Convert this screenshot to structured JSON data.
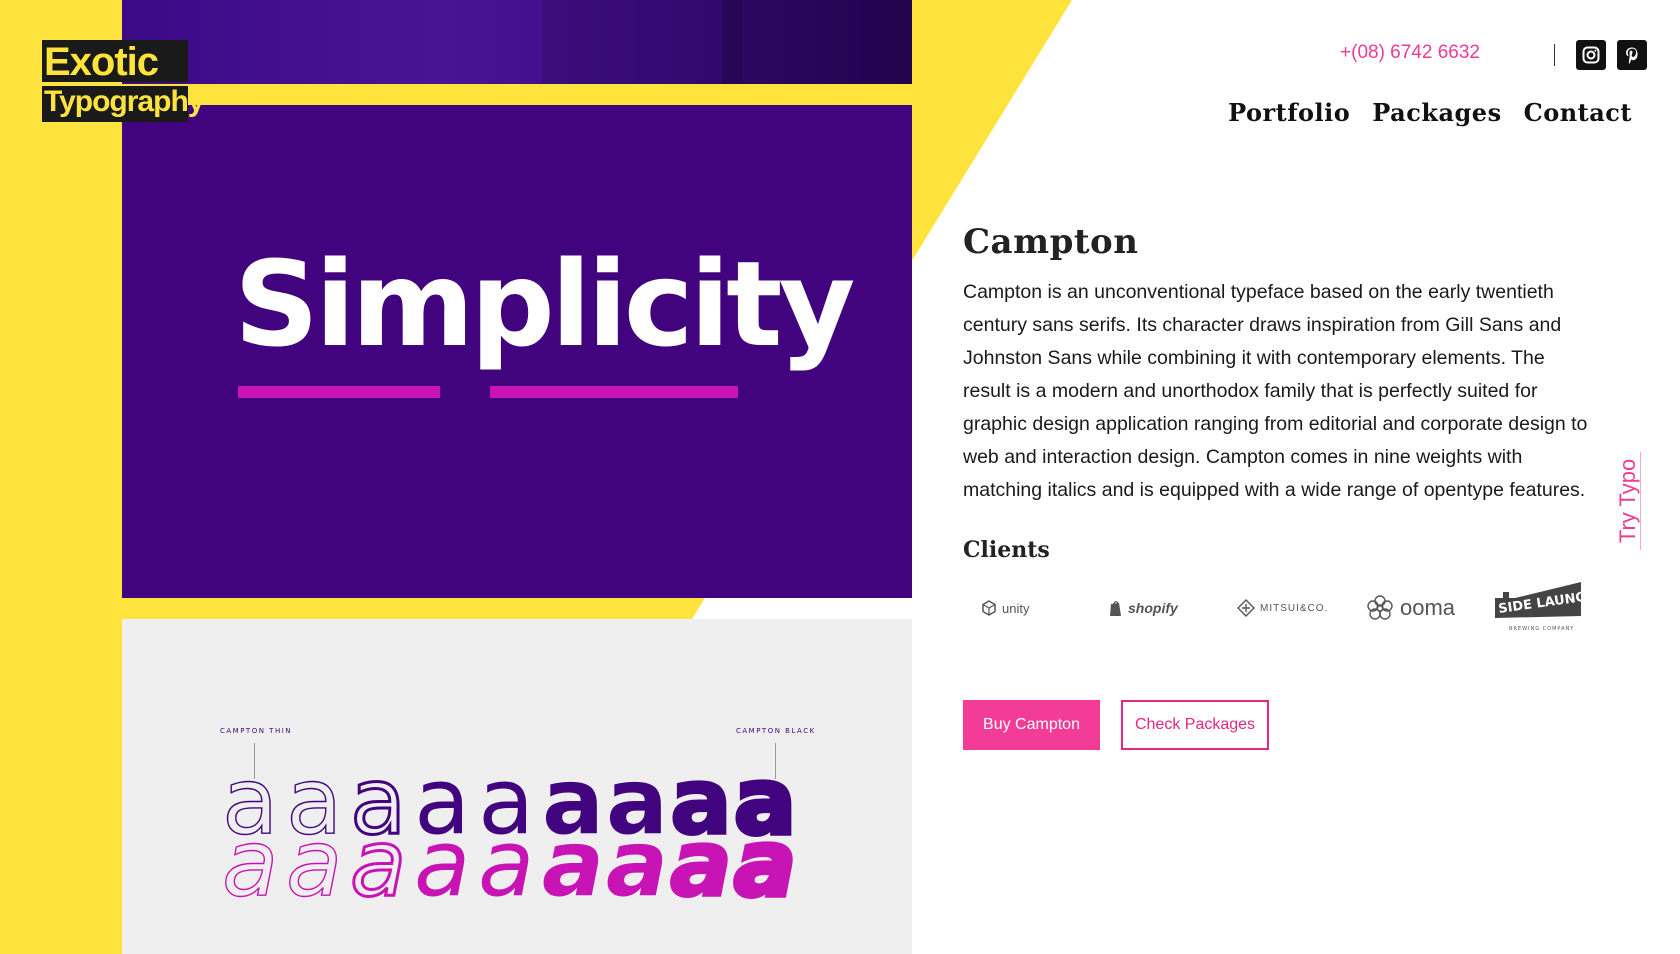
{
  "brand": {
    "logo_line1": "Exotic",
    "logo_line2": "Typography"
  },
  "header": {
    "phone": "+(08) 6742 6632",
    "social": [
      "instagram-icon",
      "pinterest-icon"
    ],
    "nav": [
      "Portfolio",
      "Packages",
      "Contact"
    ]
  },
  "hero": {
    "word": "Simplicity"
  },
  "weights": {
    "label_thin": "CAMPTON THIN",
    "label_black": "CAMPTON BLACK",
    "glyph": "a",
    "upright_colors": [
      "#42047e",
      "#42047e",
      "#42047e",
      "#42047e",
      "#42047e",
      "#42047e",
      "#42047e",
      "#42047e",
      "#42047e"
    ],
    "italic_colors": [
      "#c814b4",
      "#c814b4",
      "#c814b4",
      "#c814b4",
      "#c814b4",
      "#c814b4",
      "#c814b4",
      "#c814b4",
      "#c814b4"
    ],
    "weights_sequence": [
      100,
      200,
      300,
      400,
      500,
      600,
      700,
      800,
      900
    ]
  },
  "font": {
    "title": "Campton",
    "description": "Campton is an unconventional typeface based on the early twentieth century sans serifs. Its character draws inspiration from Gill Sans and Johnston Sans while combining it with contemporary elements. The result is a modern and unorthodox family that is perfectly suited for graphic design application ranging from editorial and corporate design to web and interaction design. Campton comes in nine weights with matching italics and is equipped with a wide range of opentype features."
  },
  "clients": {
    "heading": "Clients",
    "logos": [
      {
        "name": "unity",
        "icon": "unity-icon"
      },
      {
        "name": "shopify",
        "icon": "shopify-icon"
      },
      {
        "name": "MITSUI&CO.",
        "icon": "mitsui-icon"
      },
      {
        "name": "ooma",
        "icon": "ooma-icon"
      },
      {
        "name": "SIDE LAUNCH",
        "sub": "BREWING COMPANY",
        "icon": "sidelaunch-icon"
      }
    ]
  },
  "actions": {
    "buy": "Buy Campton",
    "check": "Check Packages"
  },
  "side_tab": {
    "label": "Try Typo"
  },
  "colors": {
    "yellow": "#fde33c",
    "purple": "#42047e",
    "magenta": "#c814b4",
    "pink": "#f23c97"
  }
}
